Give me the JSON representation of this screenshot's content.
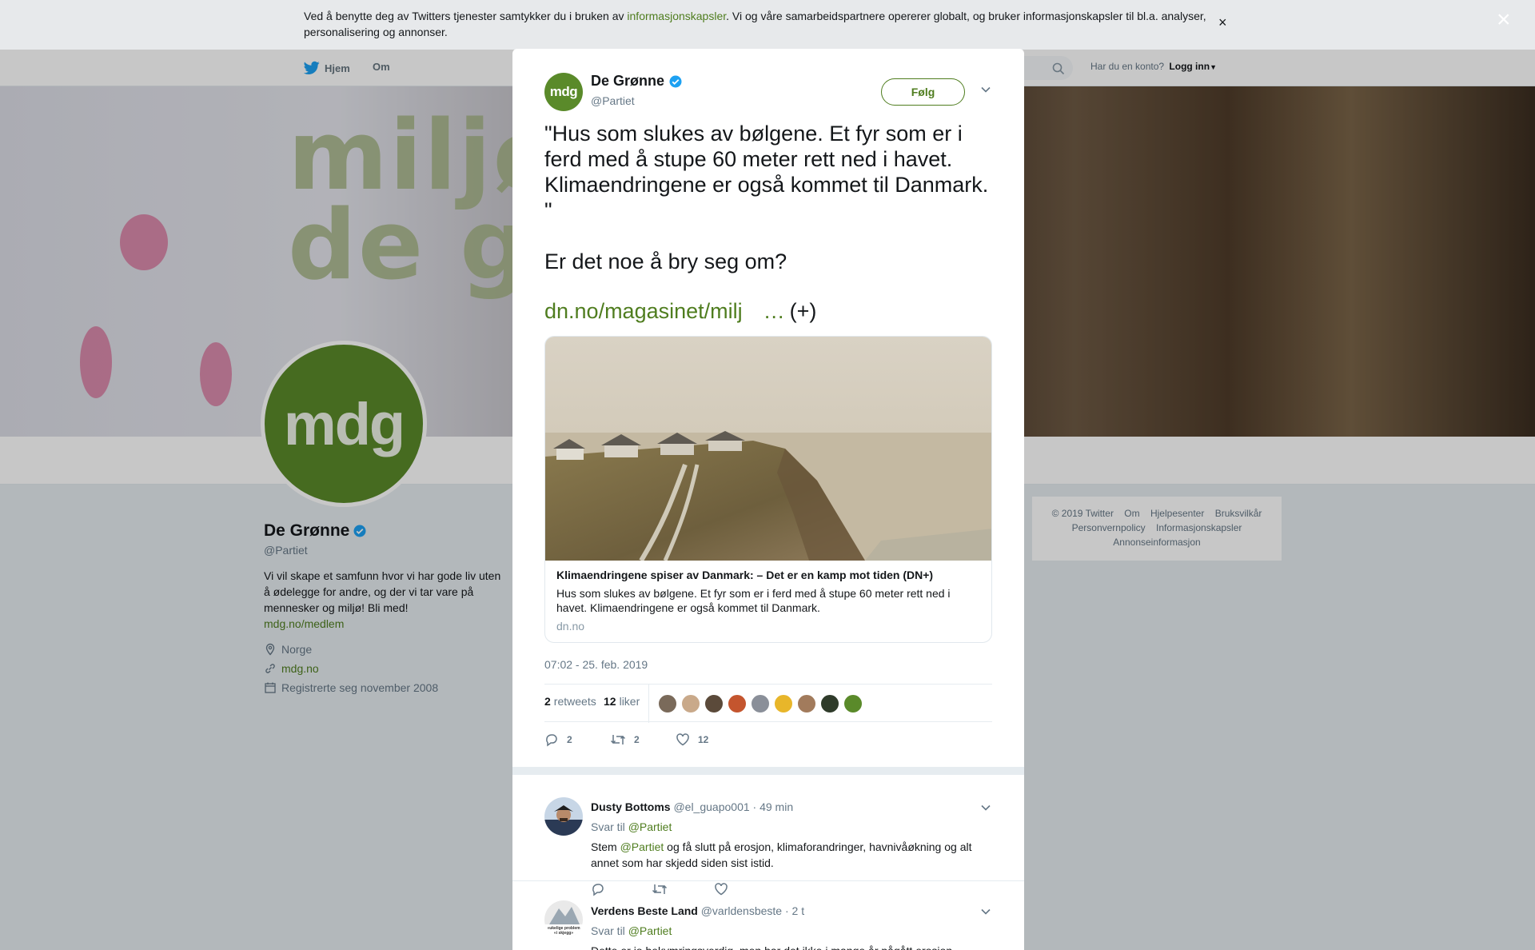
{
  "cookie_banner": {
    "text_before": "Ved å benytte deg av Twitters tjenester samtykker du i bruken av ",
    "link": "informasjonskapsler",
    "text_after": ". Vi og våre samarbeidspartnere opererer globalt, og bruker informasjonskapsler til bl.a. analyser, personalisering og annonser.",
    "close": "×"
  },
  "overlay_close": "×",
  "nav": {
    "home": "Hjem",
    "about": "Om",
    "account_prompt": "Har du en konto?",
    "login": "Logg inn"
  },
  "profile": {
    "name": "De Grønne",
    "handle": "@Partiet",
    "avatar_text": "mdg",
    "bio": "Vi vil skape et samfunn hvor vi har gode liv uten å ødelegge for andre, og der vi tar vare på mennesker og miljø! Bli med!",
    "bio_link": "mdg.no/medlem",
    "location": "Norge",
    "website": "mdg.no",
    "joined": "Registrerte seg november 2008"
  },
  "banner": {
    "line1": "miljøp",
    "line2": "de grø"
  },
  "footer": {
    "links": [
      "© 2019 Twitter",
      "Om",
      "Hjelpesenter",
      "Bruksvilkår",
      "Personvernpolicy",
      "Informasjonskapsler",
      "Annonseinformasjon"
    ]
  },
  "tweet": {
    "author_name": "De Grønne",
    "author_handle": "@Partiet",
    "avatar_text": "mdg",
    "follow_label": "Følg",
    "paragraph1": "\"Hus som slukes av bølgene. Et fyr som er i ferd med å stupe 60 meter rett ned i havet. Klimaendringene er også kommet til Danmark. \"",
    "paragraph2": "Er det noe å bry seg om?",
    "link": "dn.no/magasinet/milj",
    "ellipsis": "…",
    "plus": "(+)",
    "card": {
      "title": "Klimaendringene spiser av Danmark: – Det er en kamp mot tiden (DN+)",
      "description": "Hus som slukes av bølgene. Et fyr som er i ferd med å stupe 60 meter rett ned i havet. Klimaendringene er også kommet til Danmark.",
      "domain": "dn.no"
    },
    "timestamp": "07:02 - 25. feb. 2019",
    "retweets_count": "2",
    "retweets_label": "retweets",
    "likes_count": "12",
    "likes_label": "liker",
    "likers_colors": [
      "#7a6a5a",
      "#c9a98a",
      "#5b4a3a",
      "#c4552e",
      "#8a8f99",
      "#e8b62a",
      "#a27b5c",
      "#2f3b2a",
      "#5a8a2a"
    ],
    "reply_count": "2",
    "retweet_count": "2",
    "like_count": "12"
  },
  "replies": [
    {
      "name": "Dusty Bottoms",
      "handle": "@el_guapo001",
      "time": "· 49 min",
      "reply_to_label": "Svar til",
      "reply_to": "@Partiet",
      "text_before": "Stem ",
      "mention": "@Partiet",
      "text_after": " og få slutt på erosjon, klimaforandringer, havnivåøkning og alt annet som har skjedd siden sist istid."
    },
    {
      "name": "Verdens Beste Land",
      "handle": "@varldensbeste",
      "time": "· 2 t",
      "reply_to_label": "Svar til",
      "reply_to": "@Partiet",
      "avatar_caption": "«ukelige problem «i skjegg»",
      "text": "Dette er jo bekymringsverdig, men har det ikke i mange år pågått erosjon enkelte steder i Europa, Danmark spesielt og deler av UK sin kyst? Enkelte steder i"
    }
  ],
  "colors": {
    "brand_green": "#5a8a2a",
    "link_green": "#4f7d1f",
    "verified_blue": "#1da1f2"
  }
}
